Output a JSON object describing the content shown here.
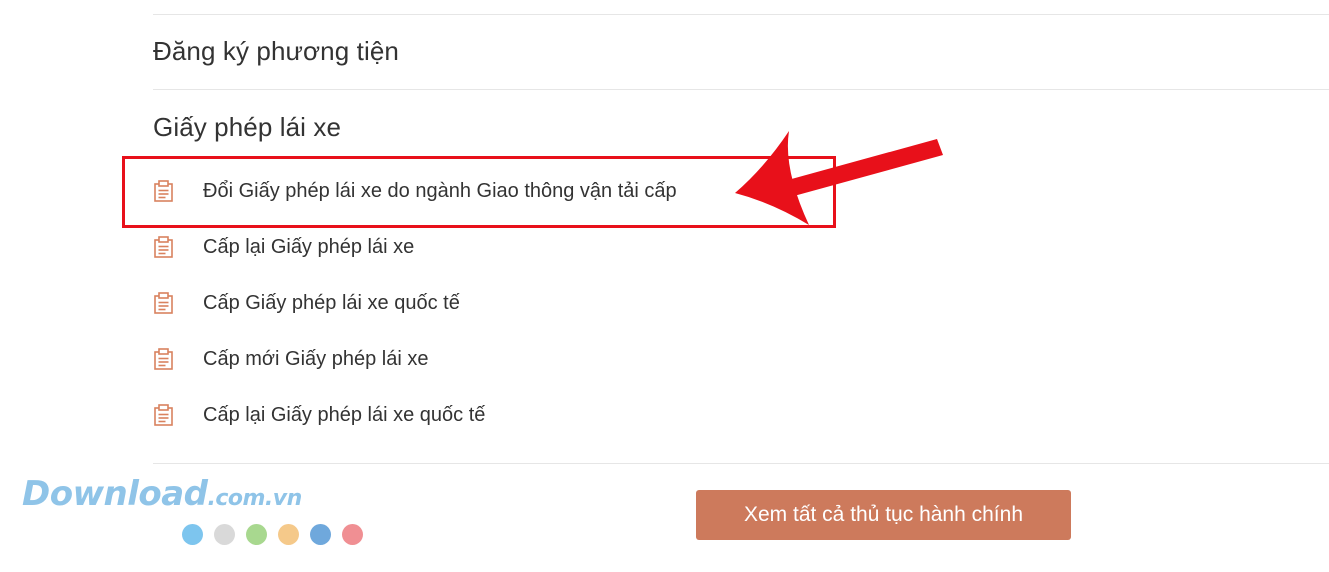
{
  "categories": [
    {
      "title": "Đăng ký phương tiện"
    },
    {
      "title": "Giấy phép lái xe"
    }
  ],
  "procedures": [
    {
      "label": "Đổi Giấy phép lái xe do ngành Giao thông vận tải cấp",
      "highlighted": true
    },
    {
      "label": "Cấp lại Giấy phép lái xe",
      "highlighted": false
    },
    {
      "label": "Cấp Giấy phép lái xe quốc tế",
      "highlighted": false
    },
    {
      "label": "Cấp mới Giấy phép lái xe",
      "highlighted": false
    },
    {
      "label": "Cấp lại Giấy phép lái xe quốc tế",
      "highlighted": false
    }
  ],
  "procedure_icon": "document-list-icon",
  "view_all_button": {
    "label": "Xem tất cả thủ tục hành chính"
  },
  "watermark": {
    "brand": "Download",
    "domain": ".com.vn"
  },
  "colors": {
    "accent": "#cd7a5c",
    "icon": "#d9825f",
    "annotation": "#e8101a",
    "text": "#333333",
    "divider": "#e6e6e6",
    "watermark_dots": [
      "#7dc5ee",
      "#d9d9d9",
      "#a8d88f",
      "#f5c98a",
      "#6fa8dc",
      "#f08f93"
    ]
  }
}
